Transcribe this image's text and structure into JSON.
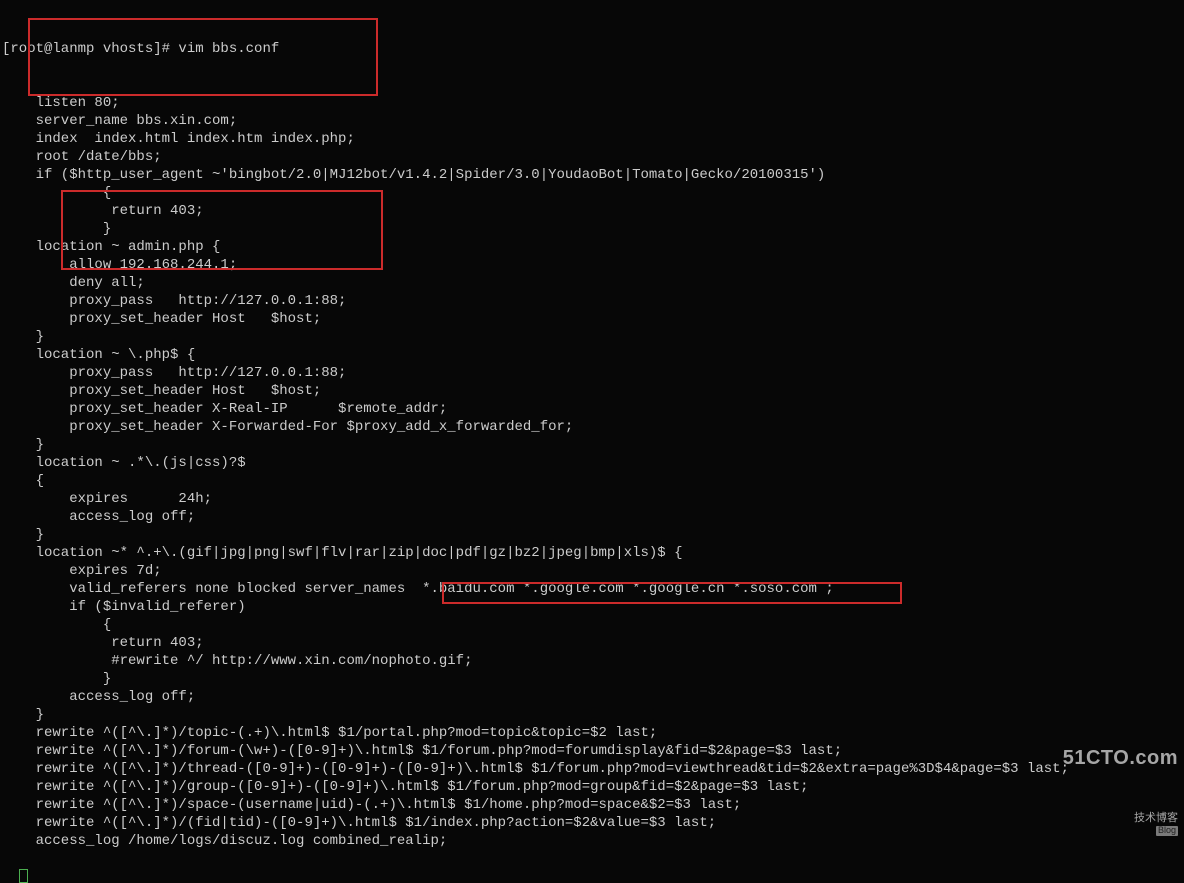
{
  "prompt": "[root@lanmp vhosts]# vim bbs.conf",
  "lines": [
    "    listen 80;",
    "    server_name bbs.xin.com;",
    "    index  index.html index.htm index.php;",
    "    root /date/bbs;",
    "",
    "    if ($http_user_agent ~'bingbot/2.0|MJ12bot/v1.4.2|Spider/3.0|YoudaoBot|Tomato|Gecko/20100315')",
    "            {",
    "             return 403;",
    "            }",
    "    location ~ admin.php {",
    "        allow 192.168.244.1;",
    "        deny all;",
    "        proxy_pass   http://127.0.0.1:88;",
    "        proxy_set_header Host   $host;",
    "    }",
    "",
    "    location ~ \\.php$ {",
    "        proxy_pass   http://127.0.0.1:88;",
    "        proxy_set_header Host   $host;",
    "        proxy_set_header X-Real-IP      $remote_addr;",
    "        proxy_set_header X-Forwarded-For $proxy_add_x_forwarded_for;",
    "    }",
    "",
    "",
    "    location ~ .*\\.(js|css)?$",
    "    {",
    "        expires      24h;",
    "        access_log off;",
    "    }",
    "",
    "    location ~* ^.+\\.(gif|jpg|png|swf|flv|rar|zip|doc|pdf|gz|bz2|jpeg|bmp|xls)$ {",
    "        expires 7d;",
    "        valid_referers none blocked server_names  *.baidu.com *.google.com *.google.cn *.soso.com ;",
    "        if ($invalid_referer)",
    "            {",
    "             return 403;",
    "             #rewrite ^/ http://www.xin.com/nophoto.gif;",
    "            }",
    "        access_log off;",
    "    }",
    "",
    "    rewrite ^([^\\.]*)/topic-(.+)\\.html$ $1/portal.php?mod=topic&topic=$2 last;",
    "    rewrite ^([^\\.]*)/forum-(\\w+)-([0-9]+)\\.html$ $1/forum.php?mod=forumdisplay&fid=$2&page=$3 last;",
    "    rewrite ^([^\\.]*)/thread-([0-9]+)-([0-9]+)-([0-9]+)\\.html$ $1/forum.php?mod=viewthread&tid=$2&extra=page%3D$4&page=$3 last;",
    "    rewrite ^([^\\.]*)/group-([0-9]+)-([0-9]+)\\.html$ $1/forum.php?mod=group&fid=$2&page=$3 last;",
    "    rewrite ^([^\\.]*)/space-(username|uid)-(.+)\\.html$ $1/home.php?mod=space&$2=$3 last;",
    "    rewrite ^([^\\.]*)/(fid|tid)-([0-9]+)\\.html$ $1/index.php?action=$2&value=$3 last;",
    "    access_log /home/logs/discuz.log combined_realip;"
  ],
  "watermark": {
    "top": "51CTO.com",
    "bot": "技术博客",
    "tag": "Blog"
  }
}
